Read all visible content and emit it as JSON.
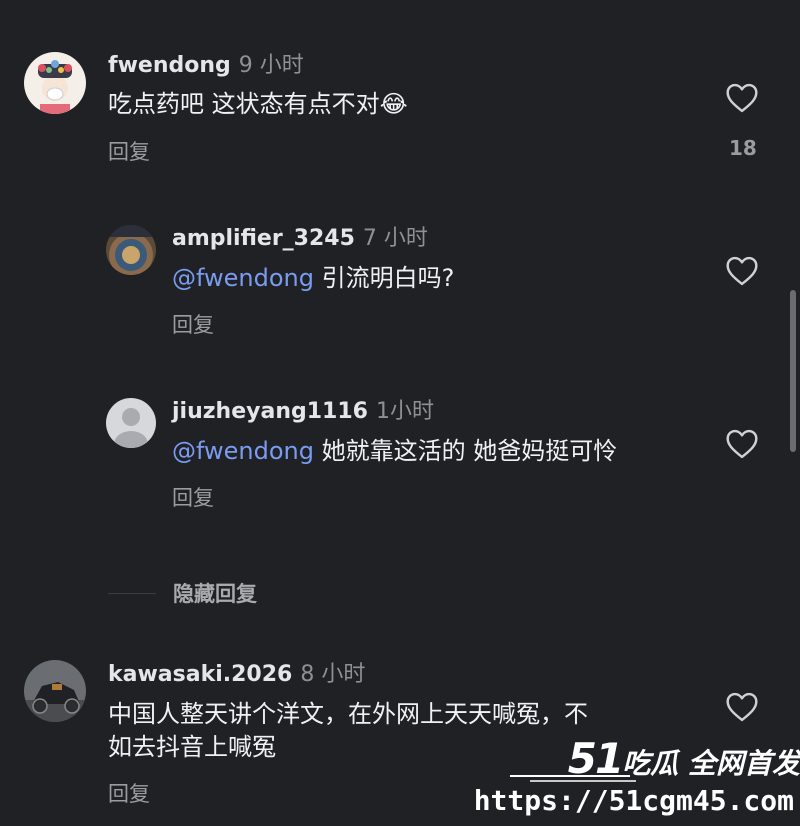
{
  "comments": [
    {
      "username": "fwendong",
      "time": "9 小时",
      "text": "吃点药吧 这状态有点不对😂",
      "reply_label": "回复",
      "likes": "18"
    },
    {
      "username": "amplifier_3245",
      "time": "7 小时",
      "mention": "@fwendong",
      "text": " 引流明白吗?",
      "reply_label": "回复"
    },
    {
      "username": "jiuzheyang1116",
      "time": "1小时",
      "mention": "@fwendong",
      "text": " 她就靠这活的 她爸妈挺可怜",
      "reply_label": "回复"
    },
    {
      "username": "kawasaki.2026",
      "time": "8 小时",
      "text_line1": "中国人整天讲个洋文，在外网上天天喊冤，不",
      "text_line2": "如去抖音上喊冤",
      "reply_label": "回复"
    }
  ],
  "hidden_replies_label": "隐藏回复",
  "watermark": {
    "number": "51",
    "tagline": "吃瓜 全网首发",
    "url": "https://51cgm45.com"
  }
}
